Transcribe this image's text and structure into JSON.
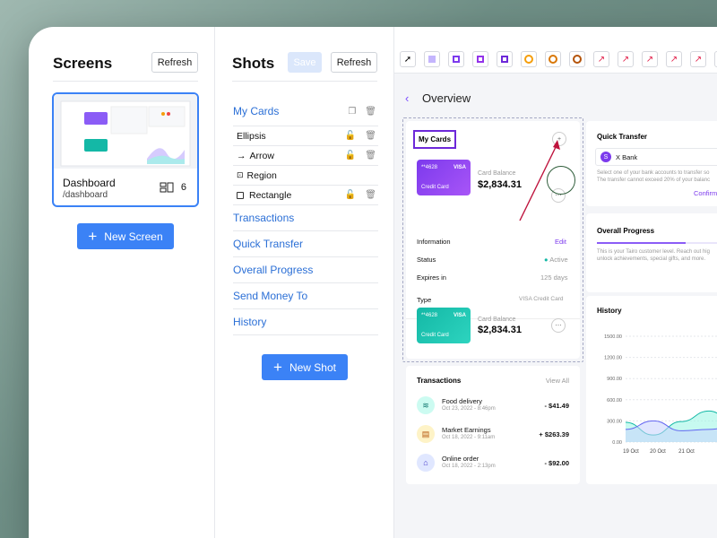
{
  "screens": {
    "title": "Screens",
    "refresh_label": "Refresh",
    "card": {
      "name": "Dashboard",
      "path": "/dashboard",
      "count": "6"
    },
    "new_button": "New Screen"
  },
  "shots": {
    "title": "Shots",
    "save_label": "Save",
    "refresh_label": "Refresh",
    "items": [
      {
        "label": "My Cards"
      },
      {
        "label": "Ellipsis"
      },
      {
        "label": "Arrow"
      },
      {
        "label": "Region"
      },
      {
        "label": "Rectangle"
      },
      {
        "label": "Transactions"
      },
      {
        "label": "Quick Transfer"
      },
      {
        "label": "Overall Progress"
      },
      {
        "label": "Send Money To"
      },
      {
        "label": "History"
      }
    ],
    "new_button": "New Shot"
  },
  "canvas": {
    "page_title": "Overview",
    "my_cards": {
      "title": "My Cards",
      "card1": {
        "number": "**4628",
        "brand": "VISA",
        "type": "Credit Card",
        "balance_label": "Card Balance",
        "balance": "$2,834.31"
      },
      "info_label": "Information",
      "edit_label": "Edit",
      "status_label": "Status",
      "status_value": "Active",
      "expires_label": "Expires in",
      "expires_value": "125 days",
      "type_label": "Type",
      "type_value": "VISA Credit Card",
      "card2": {
        "number": "**4628",
        "brand": "VISA",
        "type": "Credit Card",
        "balance_label": "Card Balance",
        "balance": "$2,834.31"
      }
    },
    "transactions": {
      "title": "Transactions",
      "view_all": "View All",
      "items": [
        {
          "name": "Food delivery",
          "date": "Oct 23, 2022 - 8:46pm",
          "amount": "- $41.49"
        },
        {
          "name": "Market Earnings",
          "date": "Oct 18, 2022 - 9:11am",
          "amount": "+ $263.39"
        },
        {
          "name": "Online order",
          "date": "Oct 18, 2022 - 2:13pm",
          "amount": "- $92.00"
        }
      ]
    },
    "quick_transfer": {
      "title": "Quick Transfer",
      "bank": "X Bank",
      "desc1": "Select one of your bank accounts to transfer so",
      "desc2": "The transfer cannot exceed 20% of your balanc",
      "confirm": "Confirm"
    },
    "overall_progress": {
      "title": "Overall Progress",
      "desc1": "This is your Tairo customer level. Reach out hig",
      "desc2": "unlock achievements, special gifts, and more."
    },
    "history": {
      "title": "History"
    }
  },
  "colors": {
    "accent": "#3b82f6",
    "purple": "#7c4dff",
    "teal": "#14b8a6"
  },
  "chart_data": {
    "type": "area",
    "x": [
      "19 Oct",
      "20 Oct",
      "21 Oct"
    ],
    "yticks": [
      "1500.00",
      "1200.00",
      "900.00",
      "600.00",
      "300.00",
      "0.00"
    ],
    "ylim": [
      0,
      1500
    ],
    "series": [
      {
        "values": [
          280,
          100,
          290,
          440,
          240
        ]
      },
      {
        "values": [
          180,
          300,
          160,
          180,
          230
        ]
      }
    ]
  }
}
